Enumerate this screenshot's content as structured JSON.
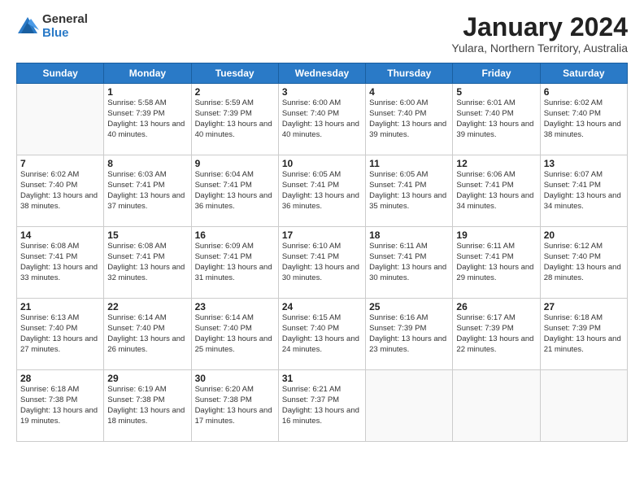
{
  "logo": {
    "general": "General",
    "blue": "Blue"
  },
  "title": {
    "month": "January 2024",
    "location": "Yulara, Northern Territory, Australia"
  },
  "headers": [
    "Sunday",
    "Monday",
    "Tuesday",
    "Wednesday",
    "Thursday",
    "Friday",
    "Saturday"
  ],
  "weeks": [
    [
      {
        "num": "",
        "info": ""
      },
      {
        "num": "1",
        "info": "Sunrise: 5:58 AM\nSunset: 7:39 PM\nDaylight: 13 hours\nand 40 minutes."
      },
      {
        "num": "2",
        "info": "Sunrise: 5:59 AM\nSunset: 7:39 PM\nDaylight: 13 hours\nand 40 minutes."
      },
      {
        "num": "3",
        "info": "Sunrise: 6:00 AM\nSunset: 7:40 PM\nDaylight: 13 hours\nand 40 minutes."
      },
      {
        "num": "4",
        "info": "Sunrise: 6:00 AM\nSunset: 7:40 PM\nDaylight: 13 hours\nand 39 minutes."
      },
      {
        "num": "5",
        "info": "Sunrise: 6:01 AM\nSunset: 7:40 PM\nDaylight: 13 hours\nand 39 minutes."
      },
      {
        "num": "6",
        "info": "Sunrise: 6:02 AM\nSunset: 7:40 PM\nDaylight: 13 hours\nand 38 minutes."
      }
    ],
    [
      {
        "num": "7",
        "info": "Sunrise: 6:02 AM\nSunset: 7:40 PM\nDaylight: 13 hours\nand 38 minutes."
      },
      {
        "num": "8",
        "info": "Sunrise: 6:03 AM\nSunset: 7:41 PM\nDaylight: 13 hours\nand 37 minutes."
      },
      {
        "num": "9",
        "info": "Sunrise: 6:04 AM\nSunset: 7:41 PM\nDaylight: 13 hours\nand 36 minutes."
      },
      {
        "num": "10",
        "info": "Sunrise: 6:05 AM\nSunset: 7:41 PM\nDaylight: 13 hours\nand 36 minutes."
      },
      {
        "num": "11",
        "info": "Sunrise: 6:05 AM\nSunset: 7:41 PM\nDaylight: 13 hours\nand 35 minutes."
      },
      {
        "num": "12",
        "info": "Sunrise: 6:06 AM\nSunset: 7:41 PM\nDaylight: 13 hours\nand 34 minutes."
      },
      {
        "num": "13",
        "info": "Sunrise: 6:07 AM\nSunset: 7:41 PM\nDaylight: 13 hours\nand 34 minutes."
      }
    ],
    [
      {
        "num": "14",
        "info": "Sunrise: 6:08 AM\nSunset: 7:41 PM\nDaylight: 13 hours\nand 33 minutes."
      },
      {
        "num": "15",
        "info": "Sunrise: 6:08 AM\nSunset: 7:41 PM\nDaylight: 13 hours\nand 32 minutes."
      },
      {
        "num": "16",
        "info": "Sunrise: 6:09 AM\nSunset: 7:41 PM\nDaylight: 13 hours\nand 31 minutes."
      },
      {
        "num": "17",
        "info": "Sunrise: 6:10 AM\nSunset: 7:41 PM\nDaylight: 13 hours\nand 30 minutes."
      },
      {
        "num": "18",
        "info": "Sunrise: 6:11 AM\nSunset: 7:41 PM\nDaylight: 13 hours\nand 30 minutes."
      },
      {
        "num": "19",
        "info": "Sunrise: 6:11 AM\nSunset: 7:41 PM\nDaylight: 13 hours\nand 29 minutes."
      },
      {
        "num": "20",
        "info": "Sunrise: 6:12 AM\nSunset: 7:40 PM\nDaylight: 13 hours\nand 28 minutes."
      }
    ],
    [
      {
        "num": "21",
        "info": "Sunrise: 6:13 AM\nSunset: 7:40 PM\nDaylight: 13 hours\nand 27 minutes."
      },
      {
        "num": "22",
        "info": "Sunrise: 6:14 AM\nSunset: 7:40 PM\nDaylight: 13 hours\nand 26 minutes."
      },
      {
        "num": "23",
        "info": "Sunrise: 6:14 AM\nSunset: 7:40 PM\nDaylight: 13 hours\nand 25 minutes."
      },
      {
        "num": "24",
        "info": "Sunrise: 6:15 AM\nSunset: 7:40 PM\nDaylight: 13 hours\nand 24 minutes."
      },
      {
        "num": "25",
        "info": "Sunrise: 6:16 AM\nSunset: 7:39 PM\nDaylight: 13 hours\nand 23 minutes."
      },
      {
        "num": "26",
        "info": "Sunrise: 6:17 AM\nSunset: 7:39 PM\nDaylight: 13 hours\nand 22 minutes."
      },
      {
        "num": "27",
        "info": "Sunrise: 6:18 AM\nSunset: 7:39 PM\nDaylight: 13 hours\nand 21 minutes."
      }
    ],
    [
      {
        "num": "28",
        "info": "Sunrise: 6:18 AM\nSunset: 7:38 PM\nDaylight: 13 hours\nand 19 minutes."
      },
      {
        "num": "29",
        "info": "Sunrise: 6:19 AM\nSunset: 7:38 PM\nDaylight: 13 hours\nand 18 minutes."
      },
      {
        "num": "30",
        "info": "Sunrise: 6:20 AM\nSunset: 7:38 PM\nDaylight: 13 hours\nand 17 minutes."
      },
      {
        "num": "31",
        "info": "Sunrise: 6:21 AM\nSunset: 7:37 PM\nDaylight: 13 hours\nand 16 minutes."
      },
      {
        "num": "",
        "info": ""
      },
      {
        "num": "",
        "info": ""
      },
      {
        "num": "",
        "info": ""
      }
    ]
  ]
}
